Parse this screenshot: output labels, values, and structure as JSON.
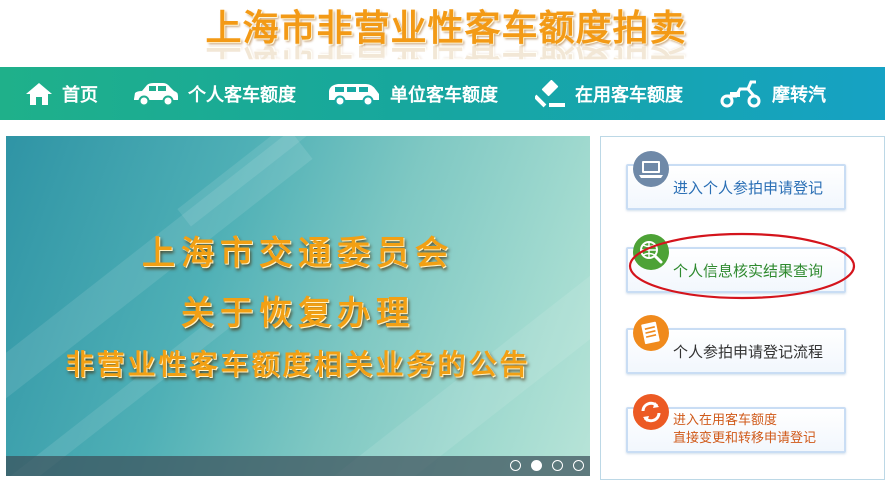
{
  "header": {
    "title": "上海市非营业性客车额度拍卖"
  },
  "nav": {
    "items": [
      {
        "label": "首页",
        "icon": "home-icon"
      },
      {
        "label": "个人客车额度",
        "icon": "car-icon"
      },
      {
        "label": "单位客车额度",
        "icon": "van-icon"
      },
      {
        "label": "在用客车额度",
        "icon": "gavel-icon"
      },
      {
        "label": "摩转汽",
        "icon": "scooter-icon"
      }
    ]
  },
  "banner": {
    "lines": [
      "上海市交通委员会",
      "关于恢复办理",
      "非营业性客车额度相关业务的公告"
    ],
    "slides": 4,
    "active_slide": 2
  },
  "side_panel": {
    "entries": [
      {
        "label": "进入个人参拍申请登记",
        "icon": "laptop-icon"
      },
      {
        "label": "个人信息核实结果查询",
        "icon": "globe-search-icon"
      },
      {
        "label": "个人参拍申请登记流程",
        "icon": "document-icon"
      },
      {
        "label_line1": "进入在用客车额度",
        "label_line2": "直接变更和转移申请登记",
        "icon": "refresh-icon"
      }
    ]
  },
  "colors": {
    "title": "#f39a16",
    "nav_start": "#1fb08a",
    "nav_end": "#16a2c4",
    "highlight": "#d4141c",
    "banner_text": "#f2a014"
  }
}
